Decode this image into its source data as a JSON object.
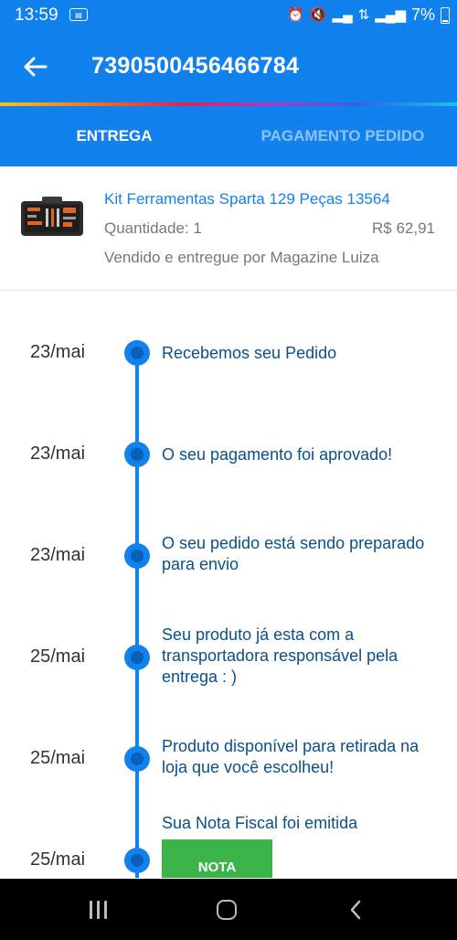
{
  "status_bar": {
    "time": "13:59",
    "battery": "7%",
    "icons": [
      "notification-app-icon",
      "alarm-icon",
      "mute-icon",
      "signal-icon",
      "data-icon",
      "signal-icon",
      "battery-icon"
    ]
  },
  "app_bar": {
    "order_number": "7390500456466784",
    "back_icon": "arrow-left-icon"
  },
  "tabs": [
    {
      "label": "ENTREGA",
      "active": true
    },
    {
      "label": "PAGAMENTO PEDIDO",
      "active": false
    }
  ],
  "product": {
    "name": "Kit Ferramentas Sparta 129 Peças 13564",
    "quantity": "Quantidade: 1",
    "price": "R$ 62,91",
    "seller": "Vendido e entregue por Magazine Luiza"
  },
  "timeline": [
    {
      "date": "23/mai",
      "text": "Recebemos seu Pedido"
    },
    {
      "date": "23/mai",
      "text": "O seu pagamento foi aprovado!"
    },
    {
      "date": "23/mai",
      "text": "O seu pedido está sendo preparado para envio"
    },
    {
      "date": "25/mai",
      "text": "Seu produto já esta com a transportadora responsável pela entrega : )"
    },
    {
      "date": "25/mai",
      "text": "Produto disponível para retirada na loja que você escolheu!"
    },
    {
      "date": "25/mai",
      "text": "Sua Nota Fiscal foi emitida",
      "button": "NOTA"
    }
  ],
  "colors": {
    "primary": "#1181ee",
    "success": "#3bb54a",
    "text_dark": "#0b4f8a"
  }
}
